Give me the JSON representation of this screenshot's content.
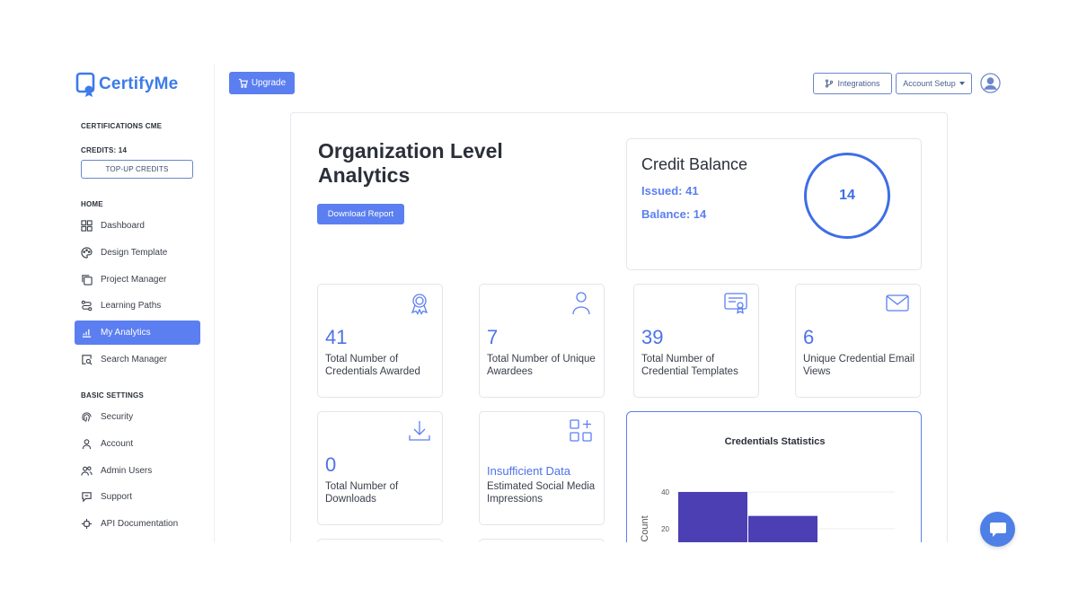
{
  "brand": {
    "name": "CertifyMe",
    "accent": "#3c7be9"
  },
  "sidebar": {
    "section_cme": "CERTIFICATIONS CME",
    "credits_label": "CREDITS: 14",
    "topup_label": "TOP-UP CREDITS",
    "home_label": "HOME",
    "basic_settings_label": "BASIC SETTINGS",
    "items": [
      {
        "label": "Dashboard",
        "icon": "grid-icon"
      },
      {
        "label": "Design Template",
        "icon": "palette-icon"
      },
      {
        "label": "Project Manager",
        "icon": "copy-icon"
      },
      {
        "label": "Learning Paths",
        "icon": "route-icon"
      },
      {
        "label": "My Analytics",
        "icon": "bar-chart-icon",
        "active": true
      },
      {
        "label": "Search Manager",
        "icon": "search-doc-icon"
      }
    ],
    "settings_items": [
      {
        "label": "Security",
        "icon": "fingerprint-icon"
      },
      {
        "label": "Account",
        "icon": "user-icon"
      },
      {
        "label": "Admin Users",
        "icon": "users-icon"
      },
      {
        "label": "Support",
        "icon": "chat-icon"
      },
      {
        "label": "API Documentation",
        "icon": "plug-icon"
      }
    ]
  },
  "header": {
    "upgrade_label": "Upgrade",
    "integrations_label": "Integrations",
    "account_setup_label": "Account Setup"
  },
  "main": {
    "title": "Organization Level Analytics",
    "download_label": "Download Report",
    "credit": {
      "title": "Credit Balance",
      "issued": "Issued: 41",
      "balance": "Balance: 14",
      "ring_value": "14"
    },
    "stats": [
      {
        "value": "41",
        "label": "Total Number of Credentials Awarded",
        "icon": "award-ribbon-icon"
      },
      {
        "value": "7",
        "label": "Total Number of Unique Awardees",
        "icon": "user-icon"
      },
      {
        "value": "39",
        "label": "Total Number of Credential Templates",
        "icon": "certificate-icon"
      },
      {
        "value": "6",
        "label": "Unique Credential Email Views",
        "icon": "mail-icon"
      },
      {
        "value": "0",
        "label": "Total Number of Downloads",
        "icon": "download-icon"
      },
      {
        "value": "Insufficient Data",
        "label": "Estimated Social Media Impressions",
        "icon": "apps-add-icon"
      }
    ]
  },
  "chart_data": {
    "type": "bar",
    "title": "Credentials Statistics",
    "ylabel": "Count",
    "xlabel": "",
    "yticks": [
      20,
      40
    ],
    "values": [
      40,
      27
    ],
    "color": "#4b3fb3"
  }
}
